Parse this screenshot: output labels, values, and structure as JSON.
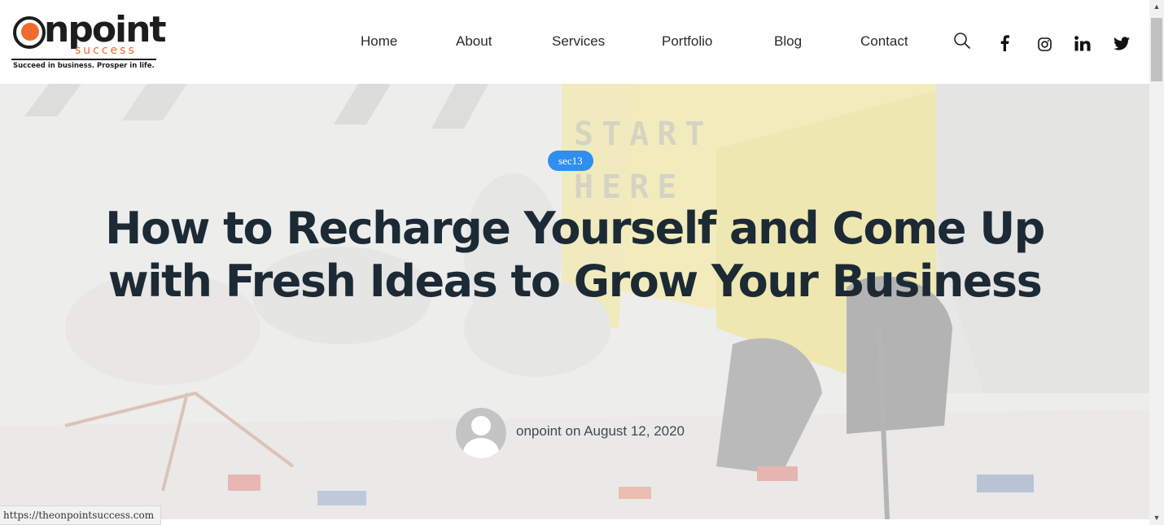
{
  "logo": {
    "word": "Onpoint",
    "sub": "success",
    "tagline": "Succeed in business. Prosper in life.",
    "accent_color": "#ee6a2f"
  },
  "nav": {
    "items": [
      {
        "label": "Home"
      },
      {
        "label": "About"
      },
      {
        "label": "Services"
      },
      {
        "label": "Portfolio"
      },
      {
        "label": "Blog"
      },
      {
        "label": "Contact"
      }
    ]
  },
  "header_icons": [
    "search-icon",
    "facebook-icon",
    "instagram-icon",
    "linkedin-icon",
    "twitter-icon"
  ],
  "post": {
    "category": "sec13",
    "title": "How to Recharge Yourself and Come Up with Fresh Ideas to Grow Your Business",
    "byline": "onpoint on August 12, 2020"
  },
  "status_bar": {
    "url": "https://theonpointsuccess.com"
  },
  "colors": {
    "badge": "#2f8ef0",
    "title": "#1c2a35"
  }
}
